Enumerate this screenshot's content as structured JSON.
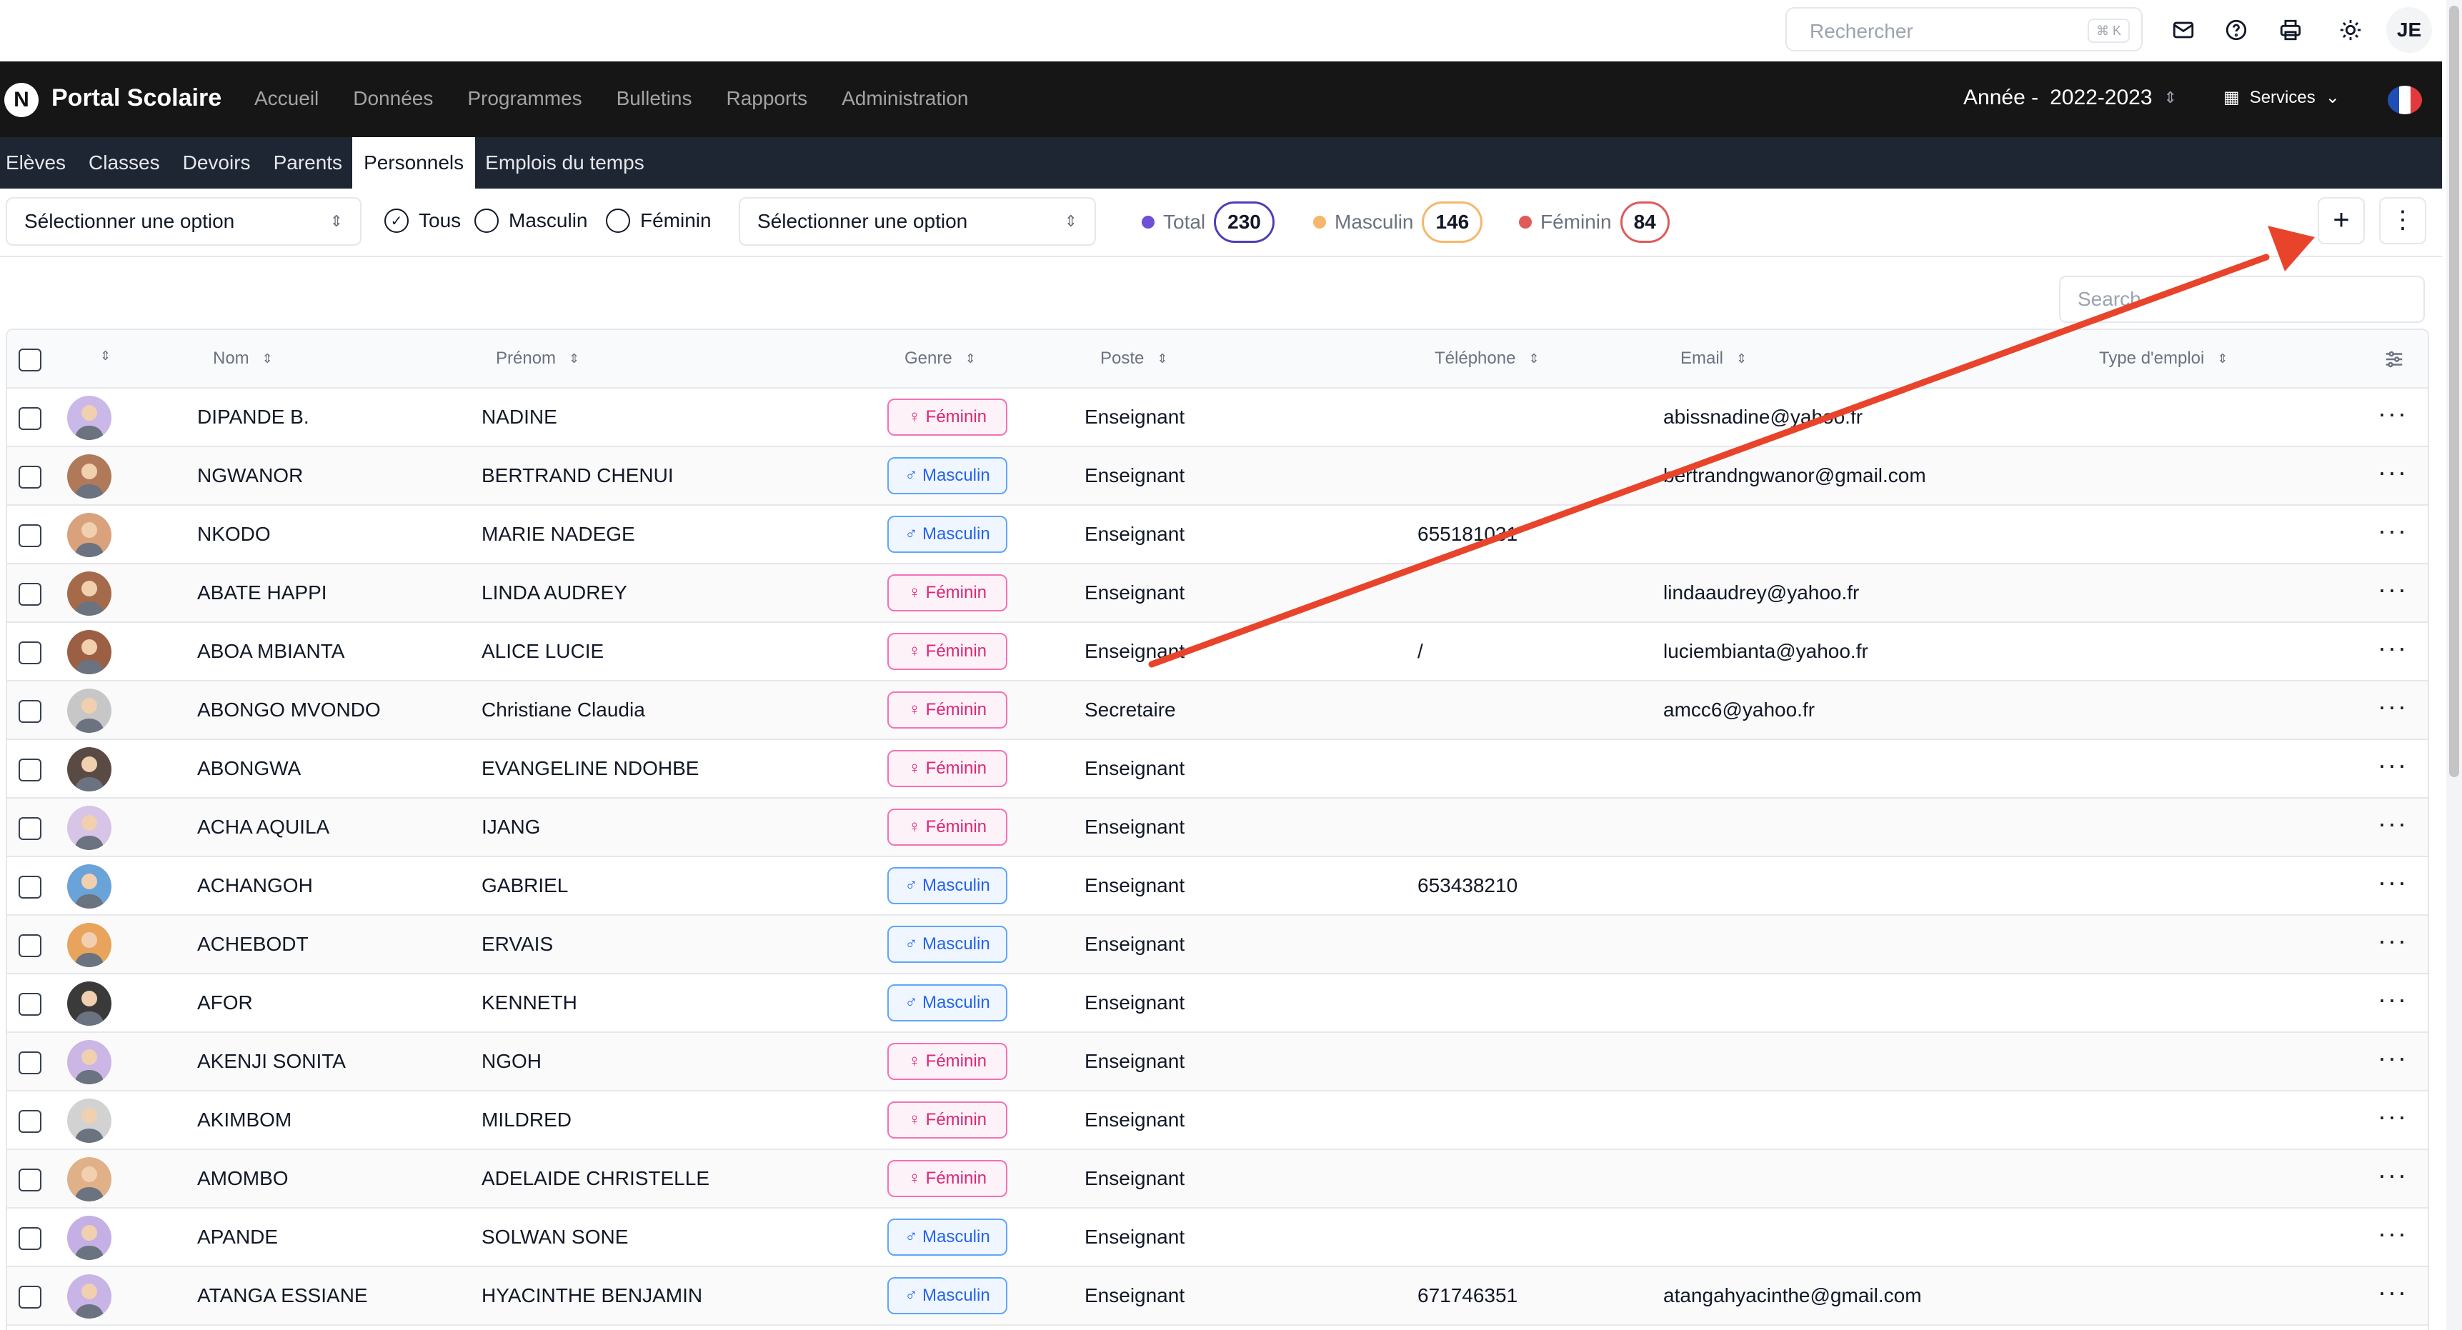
{
  "topbar": {
    "search_placeholder": "Rechercher",
    "search_shortcut": "⌘ K",
    "user_initials": "JE",
    "icons": [
      "mail-icon",
      "help-icon",
      "printer-icon",
      "sun-icon"
    ]
  },
  "nav": {
    "logo_letter": "N",
    "brand": "Portal Scolaire",
    "links": [
      "Accueil",
      "Données",
      "Programmes",
      "Bulletins",
      "Rapports",
      "Administration"
    ],
    "year_label": "Année -",
    "year_value": "2022-2023",
    "services_label": "Services"
  },
  "subnav": {
    "items": [
      "Elèves",
      "Classes",
      "Devoirs",
      "Parents",
      "Personnels",
      "Emplois du temps"
    ],
    "active": "Personnels"
  },
  "filters": {
    "select1_placeholder": "Sélectionner une option",
    "select2_placeholder": "Sélectionner une option",
    "radio_all": "Tous",
    "radio_male": "Masculin",
    "radio_female": "Féminin",
    "selected_radio": "Tous"
  },
  "stats": {
    "total_label": "Total",
    "total_value": "230",
    "male_label": "Masculin",
    "male_value": "146",
    "female_label": "Féminin",
    "female_value": "84"
  },
  "colors": {
    "total": "#6d4fd8",
    "male": "#f5b76b",
    "female": "#e05a5a",
    "annotation_arrow": "#e8442c"
  },
  "buttons": {
    "add": "+",
    "more": "⋮"
  },
  "table": {
    "search_placeholder": "Search",
    "headers": {
      "nom": "Nom",
      "prenom": "Prénom",
      "genre": "Genre",
      "poste": "Poste",
      "telephone": "Téléphone",
      "email": "Email",
      "type_emploi": "Type d'emploi"
    },
    "rows": [
      {
        "nom": "DIPANDE B.",
        "prenom": "NADINE",
        "genre": "Féminin",
        "g": "f",
        "poste": "Enseignant",
        "tel": "",
        "email": "abissnadine@yahoo.fr"
      },
      {
        "nom": "NGWANOR",
        "prenom": "BERTRAND CHENUI",
        "genre": "Masculin",
        "g": "m",
        "poste": "Enseignant",
        "tel": "",
        "email": "bertrandngwanor@gmail.com"
      },
      {
        "nom": "NKODO",
        "prenom": "MARIE NADEGE",
        "genre": "Masculin",
        "g": "m",
        "poste": "Enseignant",
        "tel": "655181031",
        "email": ""
      },
      {
        "nom": "ABATE HAPPI",
        "prenom": "LINDA AUDREY",
        "genre": "Féminin",
        "g": "f",
        "poste": "Enseignant",
        "tel": "",
        "email": "lindaaudrey@yahoo.fr"
      },
      {
        "nom": "ABOA MBIANTA",
        "prenom": "ALICE LUCIE",
        "genre": "Féminin",
        "g": "f",
        "poste": "Enseignant",
        "tel": "/",
        "email": "luciembianta@yahoo.fr"
      },
      {
        "nom": "ABONGO MVONDO",
        "prenom": "Christiane Claudia",
        "genre": "Féminin",
        "g": "f",
        "poste": "Secretaire",
        "tel": "",
        "email": "amcc6@yahoo.fr"
      },
      {
        "nom": "ABONGWA",
        "prenom": "EVANGELINE NDOHBE",
        "genre": "Féminin",
        "g": "f",
        "poste": "Enseignant",
        "tel": "",
        "email": ""
      },
      {
        "nom": "ACHA AQUILA",
        "prenom": "IJANG",
        "genre": "Féminin",
        "g": "f",
        "poste": "Enseignant",
        "tel": "",
        "email": ""
      },
      {
        "nom": "ACHANGOH",
        "prenom": "GABRIEL",
        "genre": "Masculin",
        "g": "m",
        "poste": "Enseignant",
        "tel": "653438210",
        "email": ""
      },
      {
        "nom": "ACHEBODT",
        "prenom": "ERVAIS",
        "genre": "Masculin",
        "g": "m",
        "poste": "Enseignant",
        "tel": "",
        "email": ""
      },
      {
        "nom": "AFOR",
        "prenom": "KENNETH",
        "genre": "Masculin",
        "g": "m",
        "poste": "Enseignant",
        "tel": "",
        "email": ""
      },
      {
        "nom": "AKENJI SONITA",
        "prenom": "NGOH",
        "genre": "Féminin",
        "g": "f",
        "poste": "Enseignant",
        "tel": "",
        "email": ""
      },
      {
        "nom": "AKIMBOM",
        "prenom": "MILDRED",
        "genre": "Féminin",
        "g": "f",
        "poste": "Enseignant",
        "tel": "",
        "email": ""
      },
      {
        "nom": "AMOMBO",
        "prenom": "ADELAIDE CHRISTELLE",
        "genre": "Féminin",
        "g": "f",
        "poste": "Enseignant",
        "tel": "",
        "email": ""
      },
      {
        "nom": "APANDE",
        "prenom": "SOLWAN SONE",
        "genre": "Masculin",
        "g": "m",
        "poste": "Enseignant",
        "tel": "",
        "email": ""
      },
      {
        "nom": "ATANGA ESSIANE",
        "prenom": "HYACINTHE BENJAMIN",
        "genre": "Masculin",
        "g": "m",
        "poste": "Enseignant",
        "tel": "671746351",
        "email": "atangahyacinthe@gmail.com"
      }
    ]
  }
}
